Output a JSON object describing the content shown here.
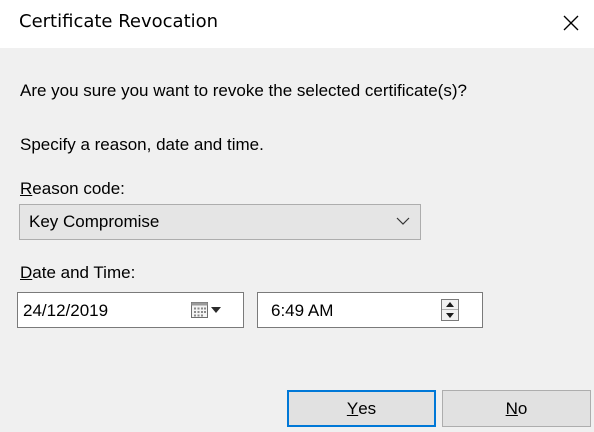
{
  "window": {
    "title": "Certificate Revocation"
  },
  "body": {
    "question": "Are you sure you want to revoke the selected certificate(s)?",
    "instruction": "Specify a reason, date and time."
  },
  "reason": {
    "label_mnemonic": "R",
    "label_rest": "eason code:",
    "selected": "Key Compromise"
  },
  "datetime": {
    "label_mnemonic": "D",
    "label_rest": "ate and Time:",
    "date": "24/12/2019",
    "time": "6:49 AM"
  },
  "buttons": {
    "yes_mnemonic": "Y",
    "yes_rest": "es",
    "no_mnemonic": "N",
    "no_rest": "o"
  },
  "icons": {
    "close": "close-icon",
    "combo_arrow": "chevron-down-icon",
    "calendar": "calendar-icon",
    "dropdown": "caret-down-icon",
    "spin_up": "spin-up-icon",
    "spin_down": "spin-down-icon"
  },
  "colors": {
    "body_background": "#f0f0f0",
    "default_button_border": "#0078d7"
  }
}
